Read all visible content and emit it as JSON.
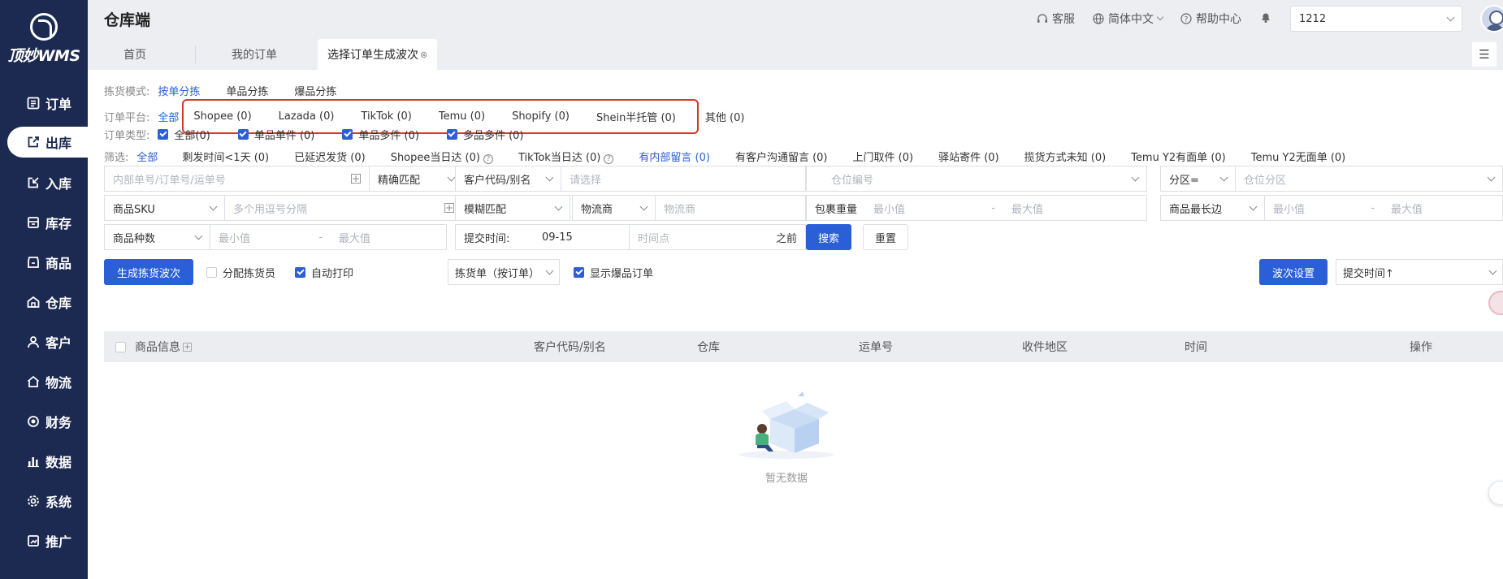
{
  "brand": {
    "logo_text": "顶妙WMS"
  },
  "sidebar": {
    "items": [
      {
        "label": "订单",
        "icon": "list-icon"
      },
      {
        "label": "出库",
        "icon": "outbound-icon",
        "active": true
      },
      {
        "label": "入库",
        "icon": "inbound-icon"
      },
      {
        "label": "库存",
        "icon": "inventory-icon"
      },
      {
        "label": "商品",
        "icon": "goods-icon"
      },
      {
        "label": "仓库",
        "icon": "warehouse-icon"
      },
      {
        "label": "客户",
        "icon": "customer-icon"
      },
      {
        "label": "物流",
        "icon": "logistics-icon"
      },
      {
        "label": "财务",
        "icon": "finance-icon"
      },
      {
        "label": "数据",
        "icon": "data-icon"
      },
      {
        "label": "系统",
        "icon": "settings-icon"
      },
      {
        "label": "推广",
        "icon": "promo-icon"
      }
    ]
  },
  "header": {
    "title": "仓库端",
    "service": "客服",
    "language": "简体中文",
    "help": "帮助中心",
    "workspace": "1212"
  },
  "tabs": [
    {
      "label": "首页"
    },
    {
      "label": "我的订单"
    },
    {
      "label": "选择订单生成波次",
      "active": true
    }
  ],
  "filters": {
    "pick_mode": {
      "label": "拣货模式:",
      "options": [
        "按单分拣",
        "单品分拣",
        "爆品分拣"
      ],
      "selected": "按单分拣"
    },
    "platform": {
      "label": "订单平台:",
      "all": "全部",
      "options": [
        "Shopee (0)",
        "Lazada (0)",
        "TikTok (0)",
        "Temu (0)",
        "Shopify (0)",
        "Shein半托管 (0)"
      ],
      "other": "其他 (0)"
    },
    "order_type": {
      "label": "订单类型:",
      "options": [
        "全部(0)",
        "单品单件 (0)",
        "单品多件 (0)",
        "多品多件 (0)"
      ]
    },
    "screen": {
      "label": "筛选:",
      "all": "全部",
      "options": [
        "剩发时间<1天 (0)",
        "已延迟发货 (0)",
        "Shopee当日达 (0)",
        "TikTok当日达 (0)",
        "有内部留言 (0)",
        "有客户沟通留言 (0)",
        "上门取件 (0)",
        "驿站寄件 (0)",
        "揽货方式未知 (0)",
        "Temu Y2有面单 (0)",
        "Temu Y2无面单 (0)"
      ],
      "selected": "有内部留言 (0)"
    }
  },
  "search": {
    "order_no_ph": "内部单号/订单号/运单号",
    "match": "精确匹配",
    "customer_code": "客户代码/别名",
    "customer_ph": "请选择",
    "location_ph": "仓位编号",
    "zone": "分区=",
    "zone_ph": "仓位分区",
    "sku": "商品SKU",
    "sku_ph": "多个用逗号分隔",
    "fuzzy": "模糊匹配",
    "carrier": "物流商",
    "carrier_ph": "物流商",
    "weight": "包裹重量",
    "min_ph": "最小值",
    "max_ph": "最大值",
    "longest": "商品最长边",
    "kinds": "商品种数",
    "submit_time": "提交时间:",
    "submit_date": "09-15",
    "time_ph": "时间点",
    "before": "之前",
    "search_btn": "搜索",
    "reset_btn": "重置",
    "dash": "-"
  },
  "actions": {
    "generate": "生成拣货波次",
    "assign": "分配拣货员",
    "auto_print": "自动打印",
    "print_type": "拣货单（按订单）",
    "show_hot": "显示爆品订单",
    "wave_setting": "波次设置",
    "sort": "提交时间↑"
  },
  "table": {
    "columns": [
      "商品信息",
      "客户代码/别名",
      "仓库",
      "运单号",
      "收件地区",
      "时间",
      "操作"
    ],
    "empty": "暂无数据"
  },
  "colors": {
    "sidebar": "#1c2a52",
    "primary": "#2a5fd8",
    "highlight": "#d23a2a"
  }
}
